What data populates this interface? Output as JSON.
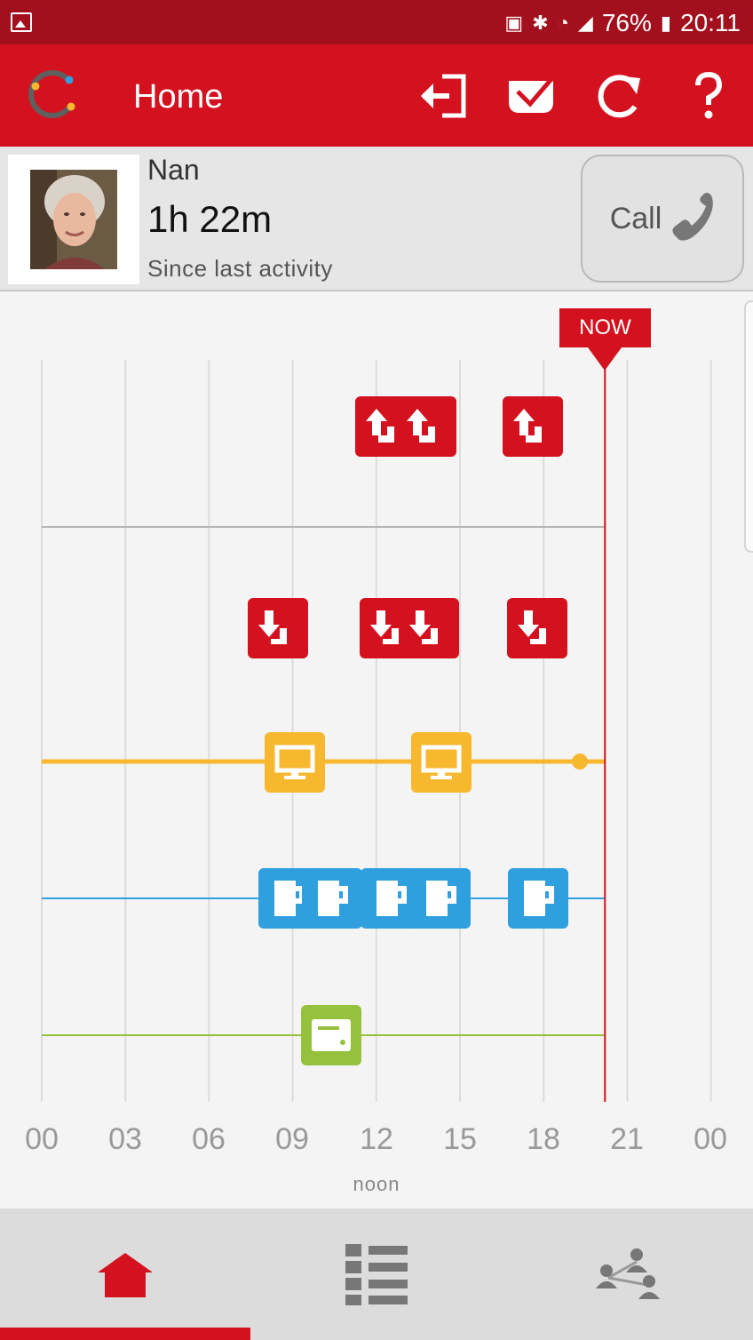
{
  "status_bar": {
    "battery": "76%",
    "time": "20:11"
  },
  "app_bar": {
    "title": "Home",
    "actions": [
      "logout-icon",
      "checkin-icon",
      "refresh-icon",
      "help-icon"
    ]
  },
  "contact": {
    "name": "Nan",
    "elapsed": "1h 22m",
    "elapsed_caption": "Since last activity",
    "call_label": "Call"
  },
  "timeline": {
    "now_label": "NOW",
    "now_hour": 20.2,
    "ticks": [
      "00",
      "03",
      "06",
      "09",
      "12",
      "15",
      "18",
      "21",
      "00"
    ],
    "noon_label": "noon",
    "colors": {
      "red": "#d4111f",
      "yellow": "#f7b830",
      "blue": "#2f9fe0",
      "green": "#96c13c",
      "grid": "#dcdcdc"
    },
    "lanes": [
      {
        "name": "up",
        "icon": "arrow-up-icon",
        "color": "red",
        "events_hours": [
          12.2,
          13.9,
          17.5
        ]
      },
      {
        "name": "down",
        "icon": "arrow-down-icon",
        "color": "red",
        "events_hours": [
          8.4,
          12.4,
          14.0,
          17.7
        ]
      },
      {
        "name": "tv",
        "icon": "tv-icon",
        "color": "yellow",
        "events_hours": [
          9.0,
          14.3
        ]
      },
      {
        "name": "kettle",
        "icon": "kettle-icon",
        "color": "blue",
        "events_hours": [
          8.3,
          10.0,
          12.4,
          14.3,
          17.6
        ]
      },
      {
        "name": "microwave",
        "icon": "microwave-icon",
        "color": "green",
        "events_hours": [
          10.4
        ]
      }
    ]
  },
  "bottom_nav": {
    "items": [
      "home-icon",
      "list-icon",
      "network-icon"
    ],
    "active": 0
  }
}
